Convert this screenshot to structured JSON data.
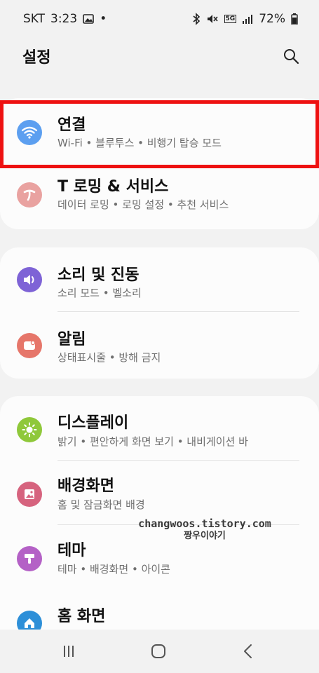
{
  "status_bar": {
    "carrier": "SKT",
    "time": "3:23",
    "dot": "•",
    "network": "5G",
    "battery": "72%"
  },
  "header": {
    "title": "설정"
  },
  "groups": [
    {
      "items": [
        {
          "title": "연결",
          "subtitle": "Wi-Fi • 블루투스 • 비행기 탑승 모드",
          "icon": "wifi-icon",
          "color": "#5c9ff0"
        },
        {
          "title": "T 로밍 & 서비스",
          "subtitle": "데이터 로밍 • 로밍 설정 • 추천 서비스",
          "icon": "t-logo-icon",
          "color": "#e9a2a0"
        }
      ]
    },
    {
      "items": [
        {
          "title": "소리 및 진동",
          "subtitle": "소리 모드 • 벨소리",
          "icon": "speaker-icon",
          "color": "#7e63d6"
        },
        {
          "title": "알림",
          "subtitle": "상태표시줄 • 방해 금지",
          "icon": "notification-icon",
          "color": "#e6766a"
        }
      ]
    },
    {
      "items": [
        {
          "title": "디스플레이",
          "subtitle": "밝기 • 편안하게 화면 보기 • 내비게이션 바",
          "icon": "brightness-icon",
          "color": "#8fc83a"
        },
        {
          "title": "배경화면",
          "subtitle": "홈 및 잠금화면 배경",
          "icon": "image-icon",
          "color": "#d6637e"
        },
        {
          "title": "테마",
          "subtitle": "테마 • 배경화면 • 아이콘",
          "icon": "paintbrush-icon",
          "color": "#b461c6"
        },
        {
          "title": "홈 화면",
          "subtitle": "",
          "icon": "home-icon",
          "color": "#2d8fd8"
        }
      ]
    }
  ],
  "watermark": {
    "line1": "changwoos.tistory.com",
    "line2": "짱우이야기"
  }
}
